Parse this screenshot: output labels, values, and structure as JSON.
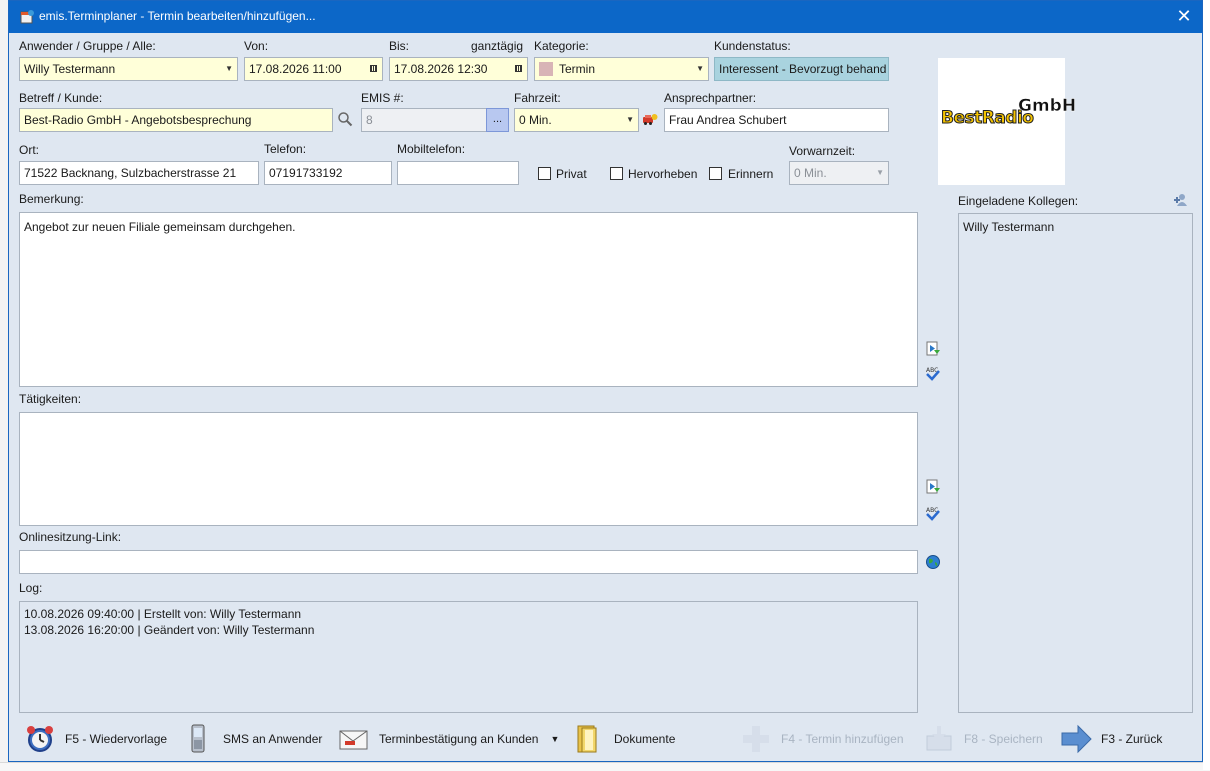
{
  "window": {
    "title": "emis.Terminplaner - Termin bearbeiten/hinzufügen..."
  },
  "labels": {
    "user_group": "Anwender / Gruppe / Alle:",
    "from": "Von:",
    "to": "Bis:",
    "all_day": "ganztägig",
    "category": "Kategorie:",
    "customer_status": "Kundenstatus:",
    "subject": "Betreff / Kunde:",
    "emis_no": "EMIS #:",
    "travel_time": "Fahrzeit:",
    "contact": "Ansprechpartner:",
    "location": "Ort:",
    "phone": "Telefon:",
    "mobile": "Mobiltelefon:",
    "private": "Privat",
    "highlight": "Hervorheben",
    "remind": "Erinnern",
    "warning_time": "Vorwarnzeit:",
    "remark": "Bemerkung:",
    "activities": "Tätigkeiten:",
    "online_link": "Onlinesitzung-Link:",
    "log": "Log:",
    "invited_colleagues": "Eingeladene Kollegen:"
  },
  "fields": {
    "user": "Willy Testermann",
    "from": "17.08.2026 11:00",
    "to": "17.08.2026 12:30",
    "category": "Termin",
    "customer_status": "Interessent - Bevorzugt behand",
    "subject": "Best-Radio GmbH - Angebotsbesprechung",
    "emis_no": "8",
    "emis_btn": "...",
    "travel_time": "0 Min.",
    "contact": "Frau Andrea Schubert",
    "location": "71522 Backnang, Sulzbacherstrasse 21",
    "phone": "07191733192",
    "mobile": "",
    "warning_time": "0 Min.",
    "remark": "Angebot zur neuen Filiale gemeinsam durchgehen.",
    "activities": "",
    "online_link": ""
  },
  "checkboxes": {
    "private": false,
    "highlight": false,
    "remind": false
  },
  "log": [
    "10.08.2026 09:40:00  |  Erstellt von: Willy Testermann",
    "13.08.2026 16:20:00  |  Geändert von: Willy Testermann"
  ],
  "invited": [
    "Willy Testermann"
  ],
  "logo": {
    "main": "BestRadio",
    "suffix": "GmbH"
  },
  "toolbar": {
    "followup": "F5 - Wiedervorlage",
    "sms": "SMS an Anwender",
    "confirmation": "Terminbestätigung an Kunden",
    "documents": "Dokumente",
    "add": "F4 - Termin hinzufügen",
    "save": "F8 - Speichern",
    "back": "F3 - Zurück"
  },
  "colors": {
    "titlebar": "#0c67c8",
    "window_bg": "#dfe7f1",
    "required_field": "#ffffd9",
    "status_field": "#a9d3df",
    "category_swatch": "#d8b4b6"
  }
}
